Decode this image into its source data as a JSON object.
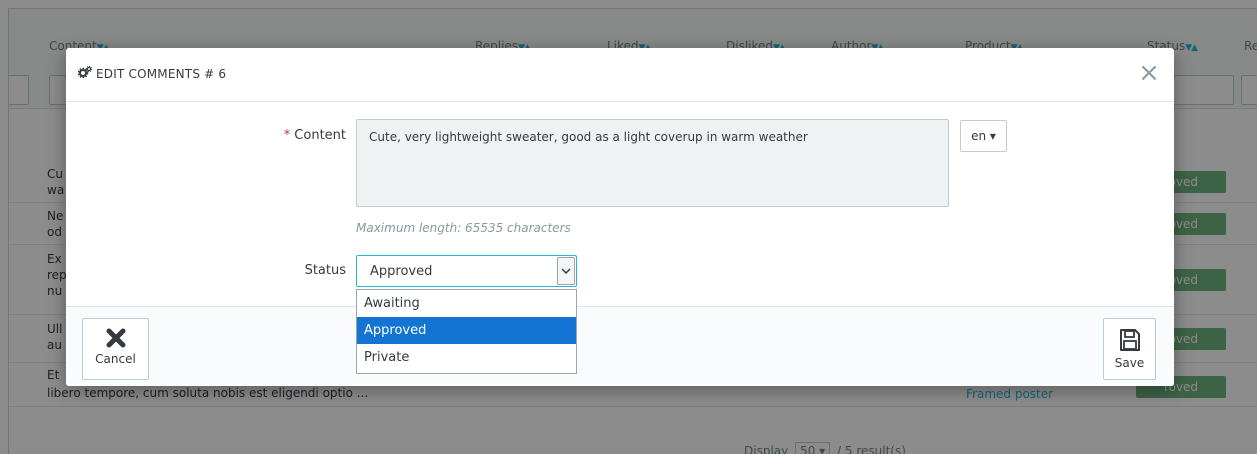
{
  "background": {
    "columns": [
      "Content",
      "Replies",
      "Liked",
      "Disliked",
      "Author",
      "Product",
      "Status",
      "Re"
    ],
    "rows": [
      {
        "text": "Cu\nwa",
        "status": "roved"
      },
      {
        "text": "Ne\nod",
        "status": "roved"
      },
      {
        "text": "Ex\nrep\nnu",
        "status": "roved"
      },
      {
        "text": "Ull\nau",
        "status": "roved"
      },
      {
        "text": "Et",
        "text2": "libero tempore, cum soluta nobis est eligendi optio ...",
        "product": "Framed poster",
        "status": "roved"
      }
    ],
    "footer": {
      "display_label": "Display",
      "per_page": "50",
      "results": "/ 5 result(s)"
    }
  },
  "modal": {
    "title": "EDIT COMMENTS # 6",
    "close_symbol": "×",
    "content": {
      "label": "Content",
      "required_mark": "*",
      "value": "Cute, very lightweight sweater, good as a light coverup in warm weather",
      "language": "en",
      "help": "Maximum length: 65535 characters"
    },
    "status": {
      "label": "Status",
      "selected": "Approved",
      "options": [
        "Awaiting",
        "Approved",
        "Private"
      ]
    },
    "footer": {
      "cancel_label": "Cancel",
      "save_label": "Save"
    }
  },
  "colors": {
    "accent": "#25b9d7",
    "selected_option": "#1474d4",
    "badge": "#70b580",
    "required": "#e02d35"
  },
  "icons": [
    "cogs-icon",
    "close-icon",
    "caret-down-icon",
    "cancel-x-icon",
    "save-disk-icon"
  ]
}
